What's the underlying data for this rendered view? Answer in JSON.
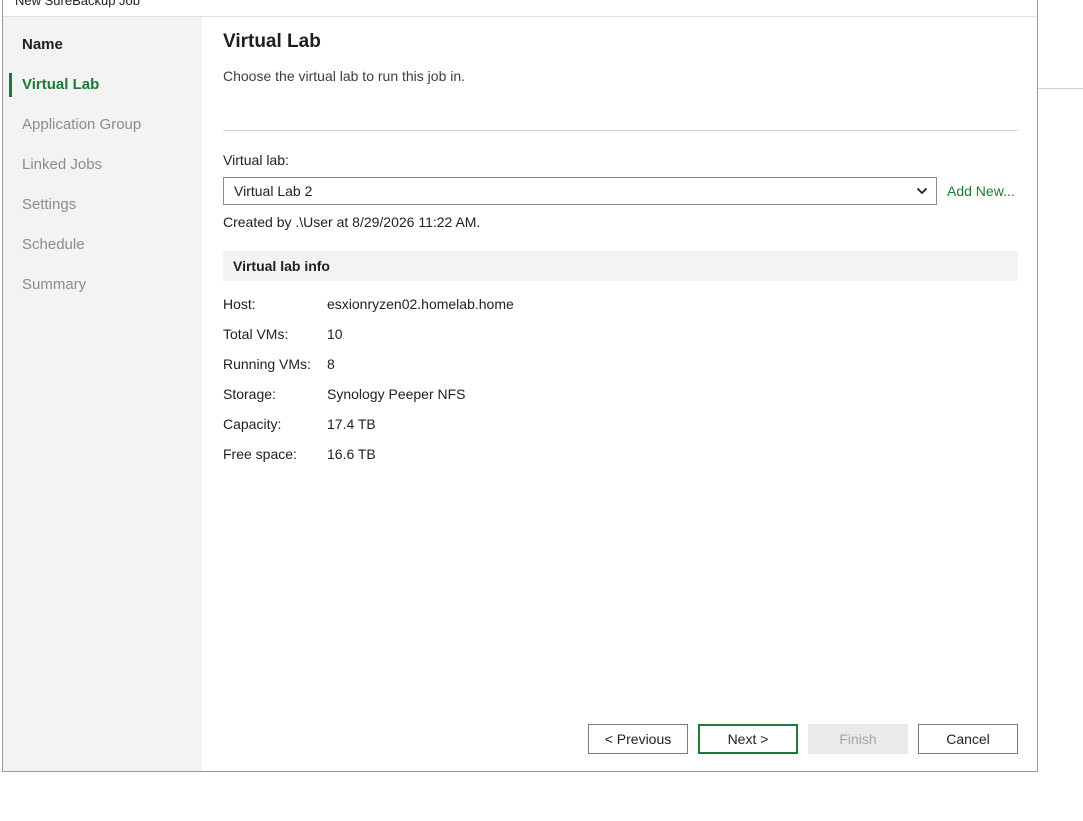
{
  "window": {
    "title": "New SureBackup Job"
  },
  "left_nav": {
    "items": [
      {
        "label": "Name",
        "state": "completed"
      },
      {
        "label": "Virtual Lab",
        "state": "current"
      },
      {
        "label": "Application Group",
        "state": "pending"
      },
      {
        "label": "Linked Jobs",
        "state": "pending"
      },
      {
        "label": "Settings",
        "state": "pending"
      },
      {
        "label": "Schedule",
        "state": "pending"
      },
      {
        "label": "Summary",
        "state": "pending"
      }
    ]
  },
  "page": {
    "title": "Virtual Lab",
    "subtitle": "Choose the virtual lab to run this job in."
  },
  "virtual_lab": {
    "label": "Virtual lab:",
    "selected": "Virtual Lab 2",
    "add_new_label": "Add New...",
    "created_note": "Created by .\\User at 8/29/2026 11:22 AM."
  },
  "info": {
    "header": "Virtual lab info",
    "rows": [
      {
        "key": "Host:",
        "value": "esxionryzen02.homelab.home"
      },
      {
        "key": "Total VMs:",
        "value": "10"
      },
      {
        "key": "Running VMs:",
        "value": "8"
      },
      {
        "key": "Storage:",
        "value": "Synology Peeper NFS"
      },
      {
        "key": "Capacity:",
        "value": "17.4 TB"
      },
      {
        "key": "Free space:",
        "value": "16.6 TB"
      }
    ]
  },
  "buttons": {
    "previous": "< Previous",
    "next": "Next >",
    "finish": "Finish",
    "cancel": "Cancel"
  },
  "colors": {
    "accent": "#1b7a34",
    "nav_background": "#f3f3f3",
    "disabled_button": "#eaeaea"
  },
  "icons": {
    "dropdown": "chevron-down-icon"
  }
}
